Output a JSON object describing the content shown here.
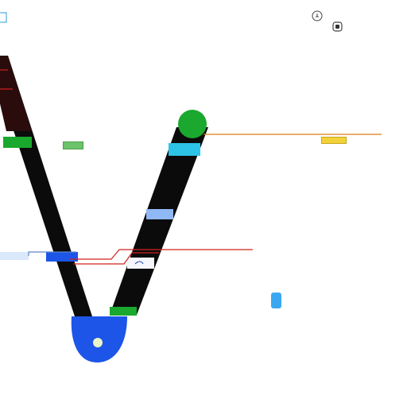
{
  "palette": {
    "stroke": "#0b0b0b",
    "dark_top": "#2a0c0c",
    "green": "#1aa82e",
    "blue": "#1d55e8",
    "cyan": "#2cc3e6",
    "light_blue": "#8fb8f5",
    "red_line": "#d0231f",
    "orange_line": "#e07a13",
    "yellow_tag": "#f2d23a",
    "green_tag": "#6cc36a",
    "sky_marker": "#3aa8f0",
    "outline_gray": "#444444"
  },
  "icons": {
    "top_left_marker": "square-outline-icon",
    "top_right_a": "circle-icon",
    "top_right_b": "rounded-square-icon",
    "green_knob": "circle-knob-icon",
    "blue_knob": "circle-knob-icon",
    "sky_marker": "rounded-rect-icon"
  },
  "labels": {
    "green_knob_mark": "",
    "near_green_knob": "",
    "green_tag": "",
    "yellow_tag": "",
    "sky_marker_text": "",
    "under_knob_1": "",
    "under_knob_2": ""
  }
}
